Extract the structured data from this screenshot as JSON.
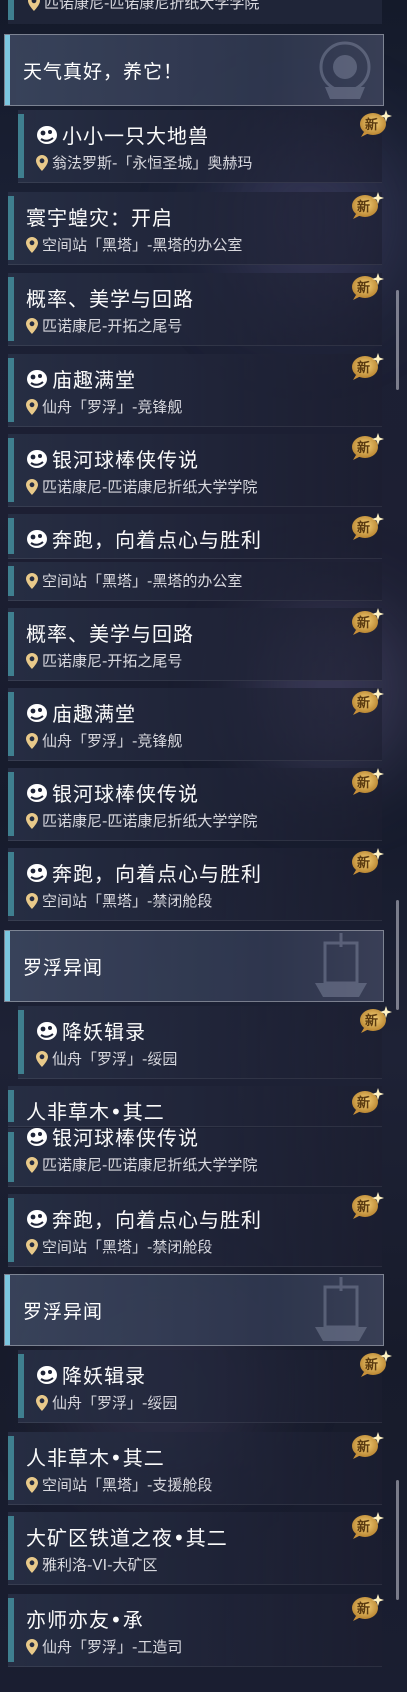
{
  "sections": {
    "weather": "天气真好，养它！",
    "luofu_1": "罗浮异闻",
    "luofu_2": "罗浮异闻"
  },
  "badge_label": "新",
  "top_cut_loc": "匹诺康尼-匹诺康尼折纸大学学院",
  "items": [
    {
      "title": "小小一只大地兽",
      "location": "翁法罗斯-「永恒圣城」奥赫玛"
    },
    {
      "title": "寰宇蝗灾：开启",
      "location": "空间站「黑塔」-黑塔的办公室"
    },
    {
      "title": "概率、美学与回路",
      "location": "匹诺康尼-开拓之尾号"
    },
    {
      "title": "庙趣满堂",
      "location": "仙舟「罗浮」-竞锋舰"
    },
    {
      "title": "银河球棒侠传说",
      "location": "匹诺康尼-匹诺康尼折纸大学学院"
    },
    {
      "title": "奔跑，向着点心与胜利",
      "location": ""
    },
    {
      "title": "",
      "location": "空间站「黑塔」-黑塔的办公室"
    },
    {
      "title": "概率、美学与回路",
      "location": "匹诺康尼-开拓之尾号"
    },
    {
      "title": "庙趣满堂",
      "location": "仙舟「罗浮」-竞锋舰"
    },
    {
      "title": "银河球棒侠传说",
      "location": "匹诺康尼-匹诺康尼折纸大学学院"
    },
    {
      "title": "奔跑，向着点心与胜利",
      "location": "空间站「黑塔」-禁闭舱段"
    },
    {
      "title": "降妖辑录",
      "location": "仙舟「罗浮」-绥园"
    },
    {
      "title": "人非草木•其二",
      "location": ""
    },
    {
      "title": "银河球棒侠传说",
      "location": "匹诺康尼-匹诺康尼折纸大学学院"
    },
    {
      "title": "奔跑，向着点心与胜利",
      "location": "空间站「黑塔」-禁闭舱段"
    },
    {
      "title": "降妖辑录",
      "location": "仙舟「罗浮」-绥园"
    },
    {
      "title": "人非草木•其二",
      "location": "空间站「黑塔」-支援舱段"
    },
    {
      "title": "大矿区铁道之夜•其二",
      "location": "雅利洛-VI-大矿区"
    },
    {
      "title": "亦师亦友•承",
      "location": "仙舟「罗浮」-工造司"
    }
  ]
}
